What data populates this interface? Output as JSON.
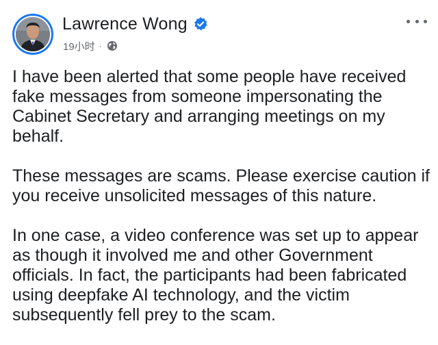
{
  "post": {
    "author": "Lawrence Wong",
    "verified_icon": "verified-badge-icon",
    "timestamp": "19小时",
    "separator": "·",
    "audience_icon": "globe-icon",
    "more_icon": "more-options-icon",
    "paragraphs": [
      "I have been alerted that some people have received\nfake messages from someone impersonating the\nCabinet Secretary and arranging meetings on my\nbehalf.",
      "These messages are scams. Please exercise caution if\nyou receive unsolicited messages of this nature.",
      "In one case, a video conference was set up to appear\nas though it involved me and other Government\nofficials. In fact, the participants had been fabricated\nusing deepfake AI technology, and the victim\nsubsequently fell prey to the scam."
    ]
  },
  "colors": {
    "accent": "#1877f2",
    "text": "#1c1e21",
    "meta": "#65676b"
  }
}
